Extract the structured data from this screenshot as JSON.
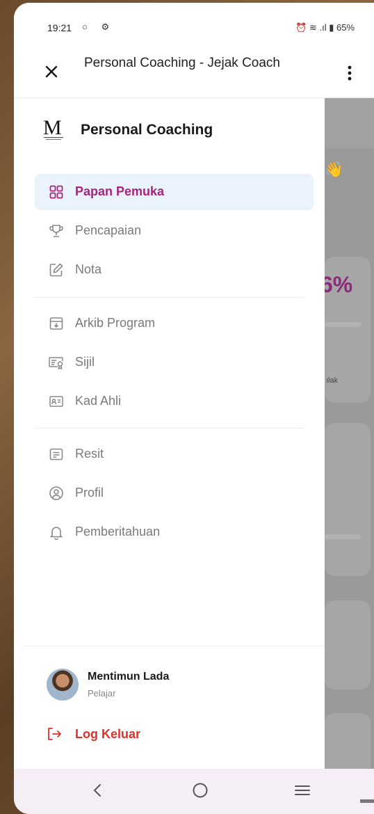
{
  "status_bar": {
    "time": "19:21",
    "left_icons": "○ ⚙",
    "right_text": "⏰ ≋ .ıl ▮ 65%"
  },
  "app_bar": {
    "title": "Personal Coaching - Jejak Coach",
    "close_icon": "close-icon",
    "menu_icon": "more-vert-icon"
  },
  "drawer": {
    "brand_title": "Personal Coaching",
    "nav_items": [
      {
        "label": "Papan Pemuka",
        "icon": "dashboard-grid-icon",
        "active": true
      },
      {
        "label": "Pencapaian",
        "icon": "trophy-icon",
        "active": false
      },
      {
        "label": "Nota",
        "icon": "edit-note-icon",
        "active": false
      },
      {
        "label": "Arkib Program",
        "icon": "archive-icon",
        "active": false
      },
      {
        "label": "Sijil",
        "icon": "certificate-icon",
        "active": false
      },
      {
        "label": "Kad Ahli",
        "icon": "member-card-icon",
        "active": false
      },
      {
        "label": "Resit",
        "icon": "receipt-icon",
        "active": false
      },
      {
        "label": "Profil",
        "icon": "profile-icon",
        "active": false
      },
      {
        "label": "Pemberitahuan",
        "icon": "bell-icon",
        "active": false
      }
    ],
    "user": {
      "name": "Mentimun Lada",
      "role": "Pelajar"
    },
    "logout_label": "Log Keluar"
  },
  "background": {
    "percent_text": "6%",
    "number_text": ")",
    "small_text": "ılak",
    "emoji": "👋"
  },
  "colors": {
    "accent": "#a8237f",
    "active_bg": "#eaf2fc",
    "logout": "#e0302a",
    "navbar_bg": "#f6eef7"
  }
}
